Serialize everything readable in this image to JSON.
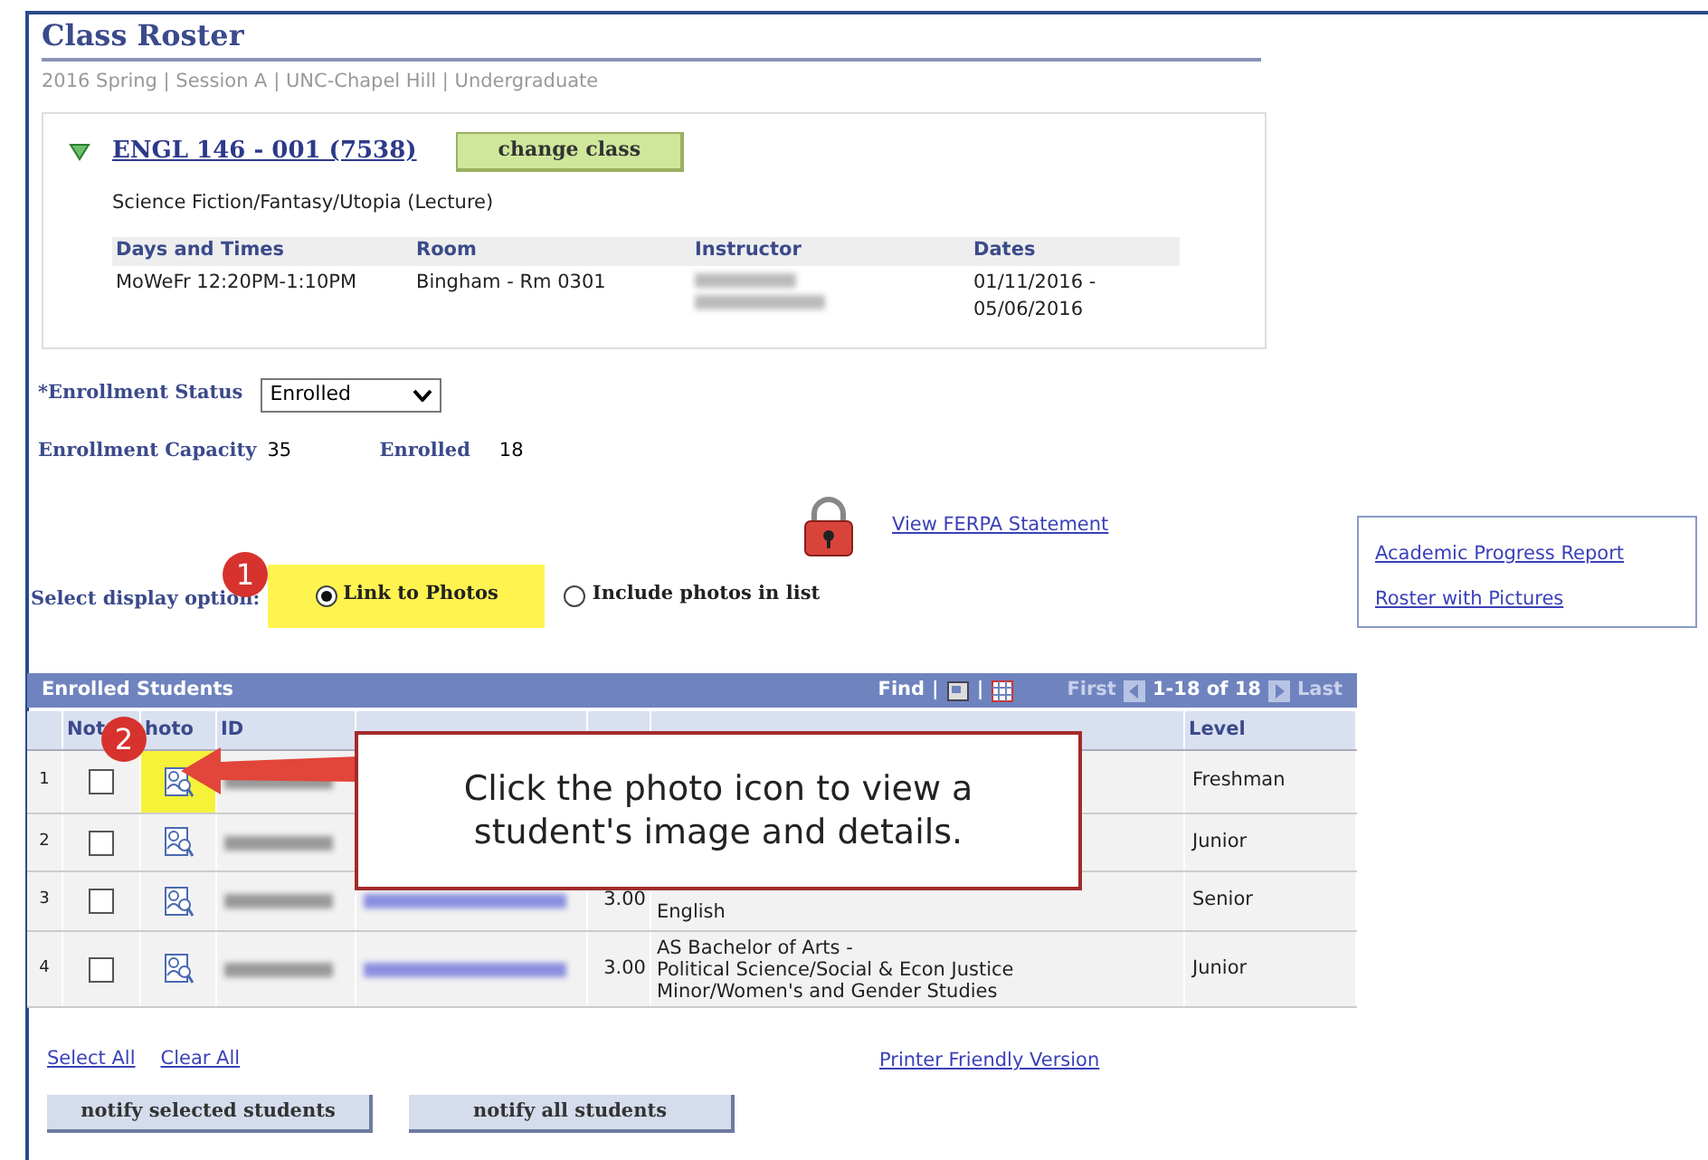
{
  "page": {
    "title": "Class Roster",
    "subtitle": "2016 Spring | Session A | UNC-Chapel Hill | Undergraduate"
  },
  "class": {
    "expanded": true,
    "link": "ENGL 146 - 001 (7538)",
    "change_button": "change class",
    "description": "Science Fiction/Fantasy/Utopia (Lecture)",
    "columns": [
      "Days and Times",
      "Room",
      "Instructor",
      "Dates"
    ],
    "row": {
      "days_times": "MoWeFr 12:20PM-1:10PM",
      "room": "Bingham - Rm 0301",
      "dates": "01/11/2016 -\n05/06/2016"
    }
  },
  "enrollment_status": {
    "label": "*Enrollment Status",
    "value": "Enrolled"
  },
  "capacity": {
    "label": "Enrollment Capacity",
    "value": "35"
  },
  "enrolled": {
    "label": "Enrolled",
    "value": "18"
  },
  "ferpa_link": "View FERPA Statement",
  "side_links": [
    "Academic Progress Report",
    "Roster with Pictures"
  ],
  "display_option": {
    "label": "Select display option:",
    "options": [
      {
        "label": "Link to Photos",
        "selected": true
      },
      {
        "label": "Include photos in list",
        "selected": false
      }
    ]
  },
  "grid": {
    "title": "Enrolled Students",
    "find": "Find",
    "separators": [
      "|",
      "|"
    ],
    "first": "First",
    "range": "1-18 of 18",
    "last": "Last",
    "columns": [
      "Not",
      "hoto",
      "ID",
      "",
      "",
      "",
      "Level"
    ],
    "rows": [
      {
        "number": "1",
        "checked": false,
        "highlighted": true,
        "units": "",
        "program": "",
        "level": "Freshman"
      },
      {
        "number": "2",
        "checked": false,
        "highlighted": false,
        "units": "",
        "program": "",
        "level": "Junior"
      },
      {
        "number": "3",
        "checked": false,
        "highlighted": false,
        "units": "3.00",
        "program": "English",
        "level": "Senior"
      },
      {
        "number": "4",
        "checked": false,
        "highlighted": false,
        "units": "3.00",
        "program": "AS Bachelor of Arts -\nPolitical Science/Social & Econ Justice\nMinor/Women's and Gender Studies",
        "level": "Junior"
      }
    ]
  },
  "footer_links": [
    "Select All",
    "Clear All"
  ],
  "printer_link": "Printer Friendly Version",
  "buttons": [
    "notify selected students",
    "notify all students"
  ],
  "annotations": {
    "step_badges": [
      "1",
      "2"
    ],
    "callout": "Click the photo icon to view a student's image and details."
  }
}
